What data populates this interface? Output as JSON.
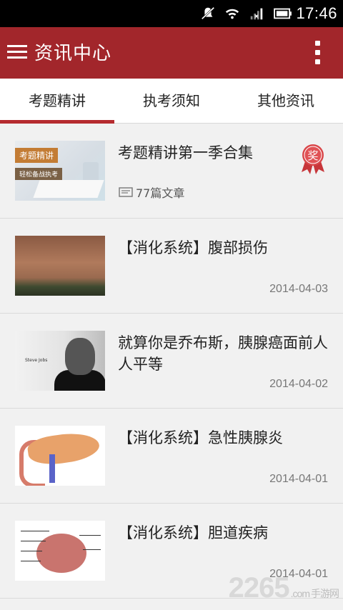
{
  "status_bar": {
    "time": "17:46",
    "icons": [
      "mute-icon",
      "wifi-icon",
      "signal-icon",
      "battery-icon"
    ]
  },
  "app_bar": {
    "title": "资讯中心",
    "menu_icon": "hamburger-menu-icon",
    "overflow_icon": "more-vertical-icon",
    "color": "#a2262b"
  },
  "tabs": [
    {
      "label": "考题精讲",
      "active": true
    },
    {
      "label": "执考须知",
      "active": false
    },
    {
      "label": "其他资讯",
      "active": false
    }
  ],
  "list": [
    {
      "title": "考题精讲第一季合集",
      "count": "77篇文章",
      "badge": "奖",
      "thumb_label": "考题精讲",
      "thumb_sub": "轻松备战执考"
    },
    {
      "title": "【消化系统】腹部损伤",
      "date": "2014-04-03"
    },
    {
      "title": "就算你是乔布斯，胰腺癌面前人人平等",
      "date": "2014-04-02",
      "thumb_label": "Steve Jobs"
    },
    {
      "title": "【消化系统】急性胰腺炎",
      "date": "2014-04-01"
    },
    {
      "title": "【消化系统】胆道疾病",
      "date": "2014-04-01"
    }
  ],
  "watermark": {
    "number": "2265",
    "suffix": ".com",
    "cn": "手游网"
  }
}
